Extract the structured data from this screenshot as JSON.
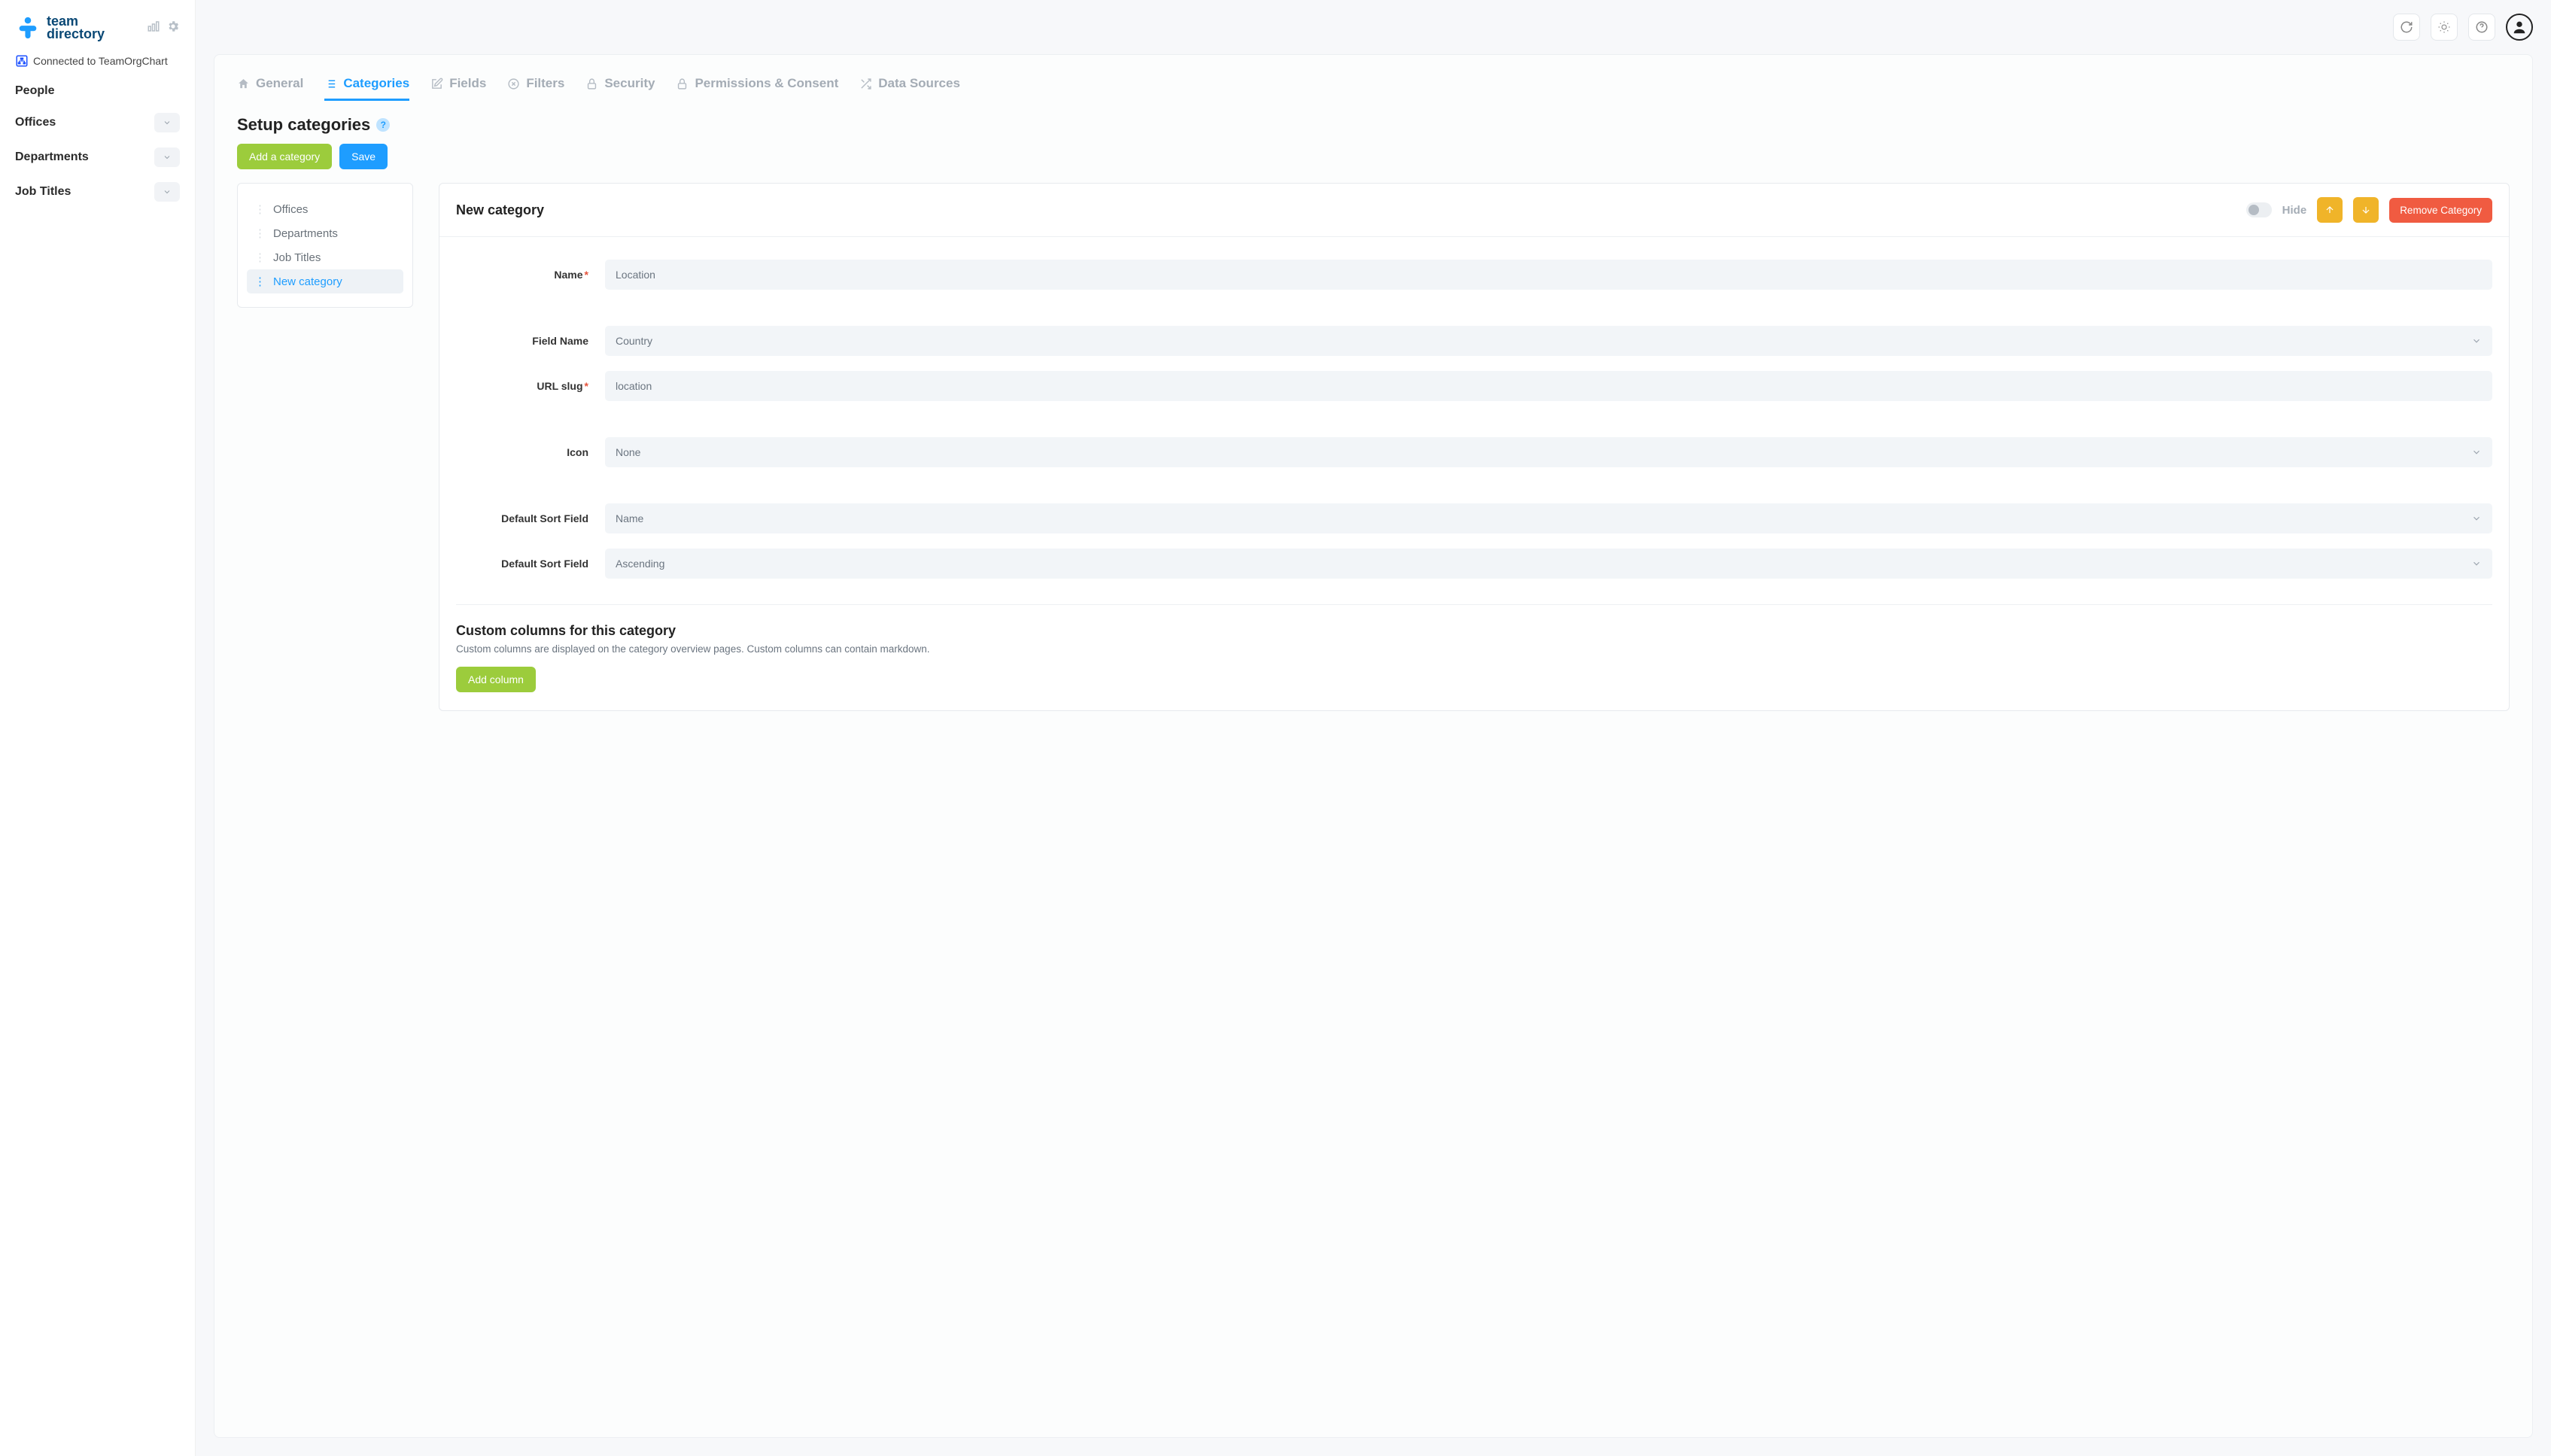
{
  "brand": {
    "line1": "team",
    "line2": "directory"
  },
  "sidebar": {
    "connected_label": "Connected to TeamOrgChart",
    "items": [
      {
        "label": "People",
        "collapsible": false
      },
      {
        "label": "Offices",
        "collapsible": true
      },
      {
        "label": "Departments",
        "collapsible": true
      },
      {
        "label": "Job Titles",
        "collapsible": true
      }
    ]
  },
  "tabs": [
    {
      "label": "General",
      "active": false
    },
    {
      "label": "Categories",
      "active": true
    },
    {
      "label": "Fields",
      "active": false
    },
    {
      "label": "Filters",
      "active": false
    },
    {
      "label": "Security",
      "active": false
    },
    {
      "label": "Permissions & Consent",
      "active": false
    },
    {
      "label": "Data Sources",
      "active": false
    }
  ],
  "page": {
    "title": "Setup categories",
    "add_button": "Add a category",
    "save_button": "Save"
  },
  "category_list": [
    {
      "label": "Offices",
      "active": false
    },
    {
      "label": "Departments",
      "active": false
    },
    {
      "label": "Job Titles",
      "active": false
    },
    {
      "label": "New category",
      "active": true
    }
  ],
  "form": {
    "title": "New category",
    "hide_label": "Hide",
    "remove_button": "Remove Category",
    "fields": {
      "name": {
        "label": "Name",
        "value": "Location",
        "required": true
      },
      "field_name": {
        "label": "Field Name",
        "value": "Country"
      },
      "url_slug": {
        "label": "URL slug",
        "value": "location",
        "required": true
      },
      "icon": {
        "label": "Icon",
        "value": "None"
      },
      "sort_field": {
        "label": "Default Sort Field",
        "value": "Name"
      },
      "sort_dir": {
        "label": "Default Sort Field",
        "value": "Ascending"
      }
    },
    "custom_cols": {
      "title": "Custom columns for this category",
      "desc": "Custom columns are displayed on the category overview pages. Custom columns can contain markdown.",
      "add_button": "Add column"
    }
  }
}
